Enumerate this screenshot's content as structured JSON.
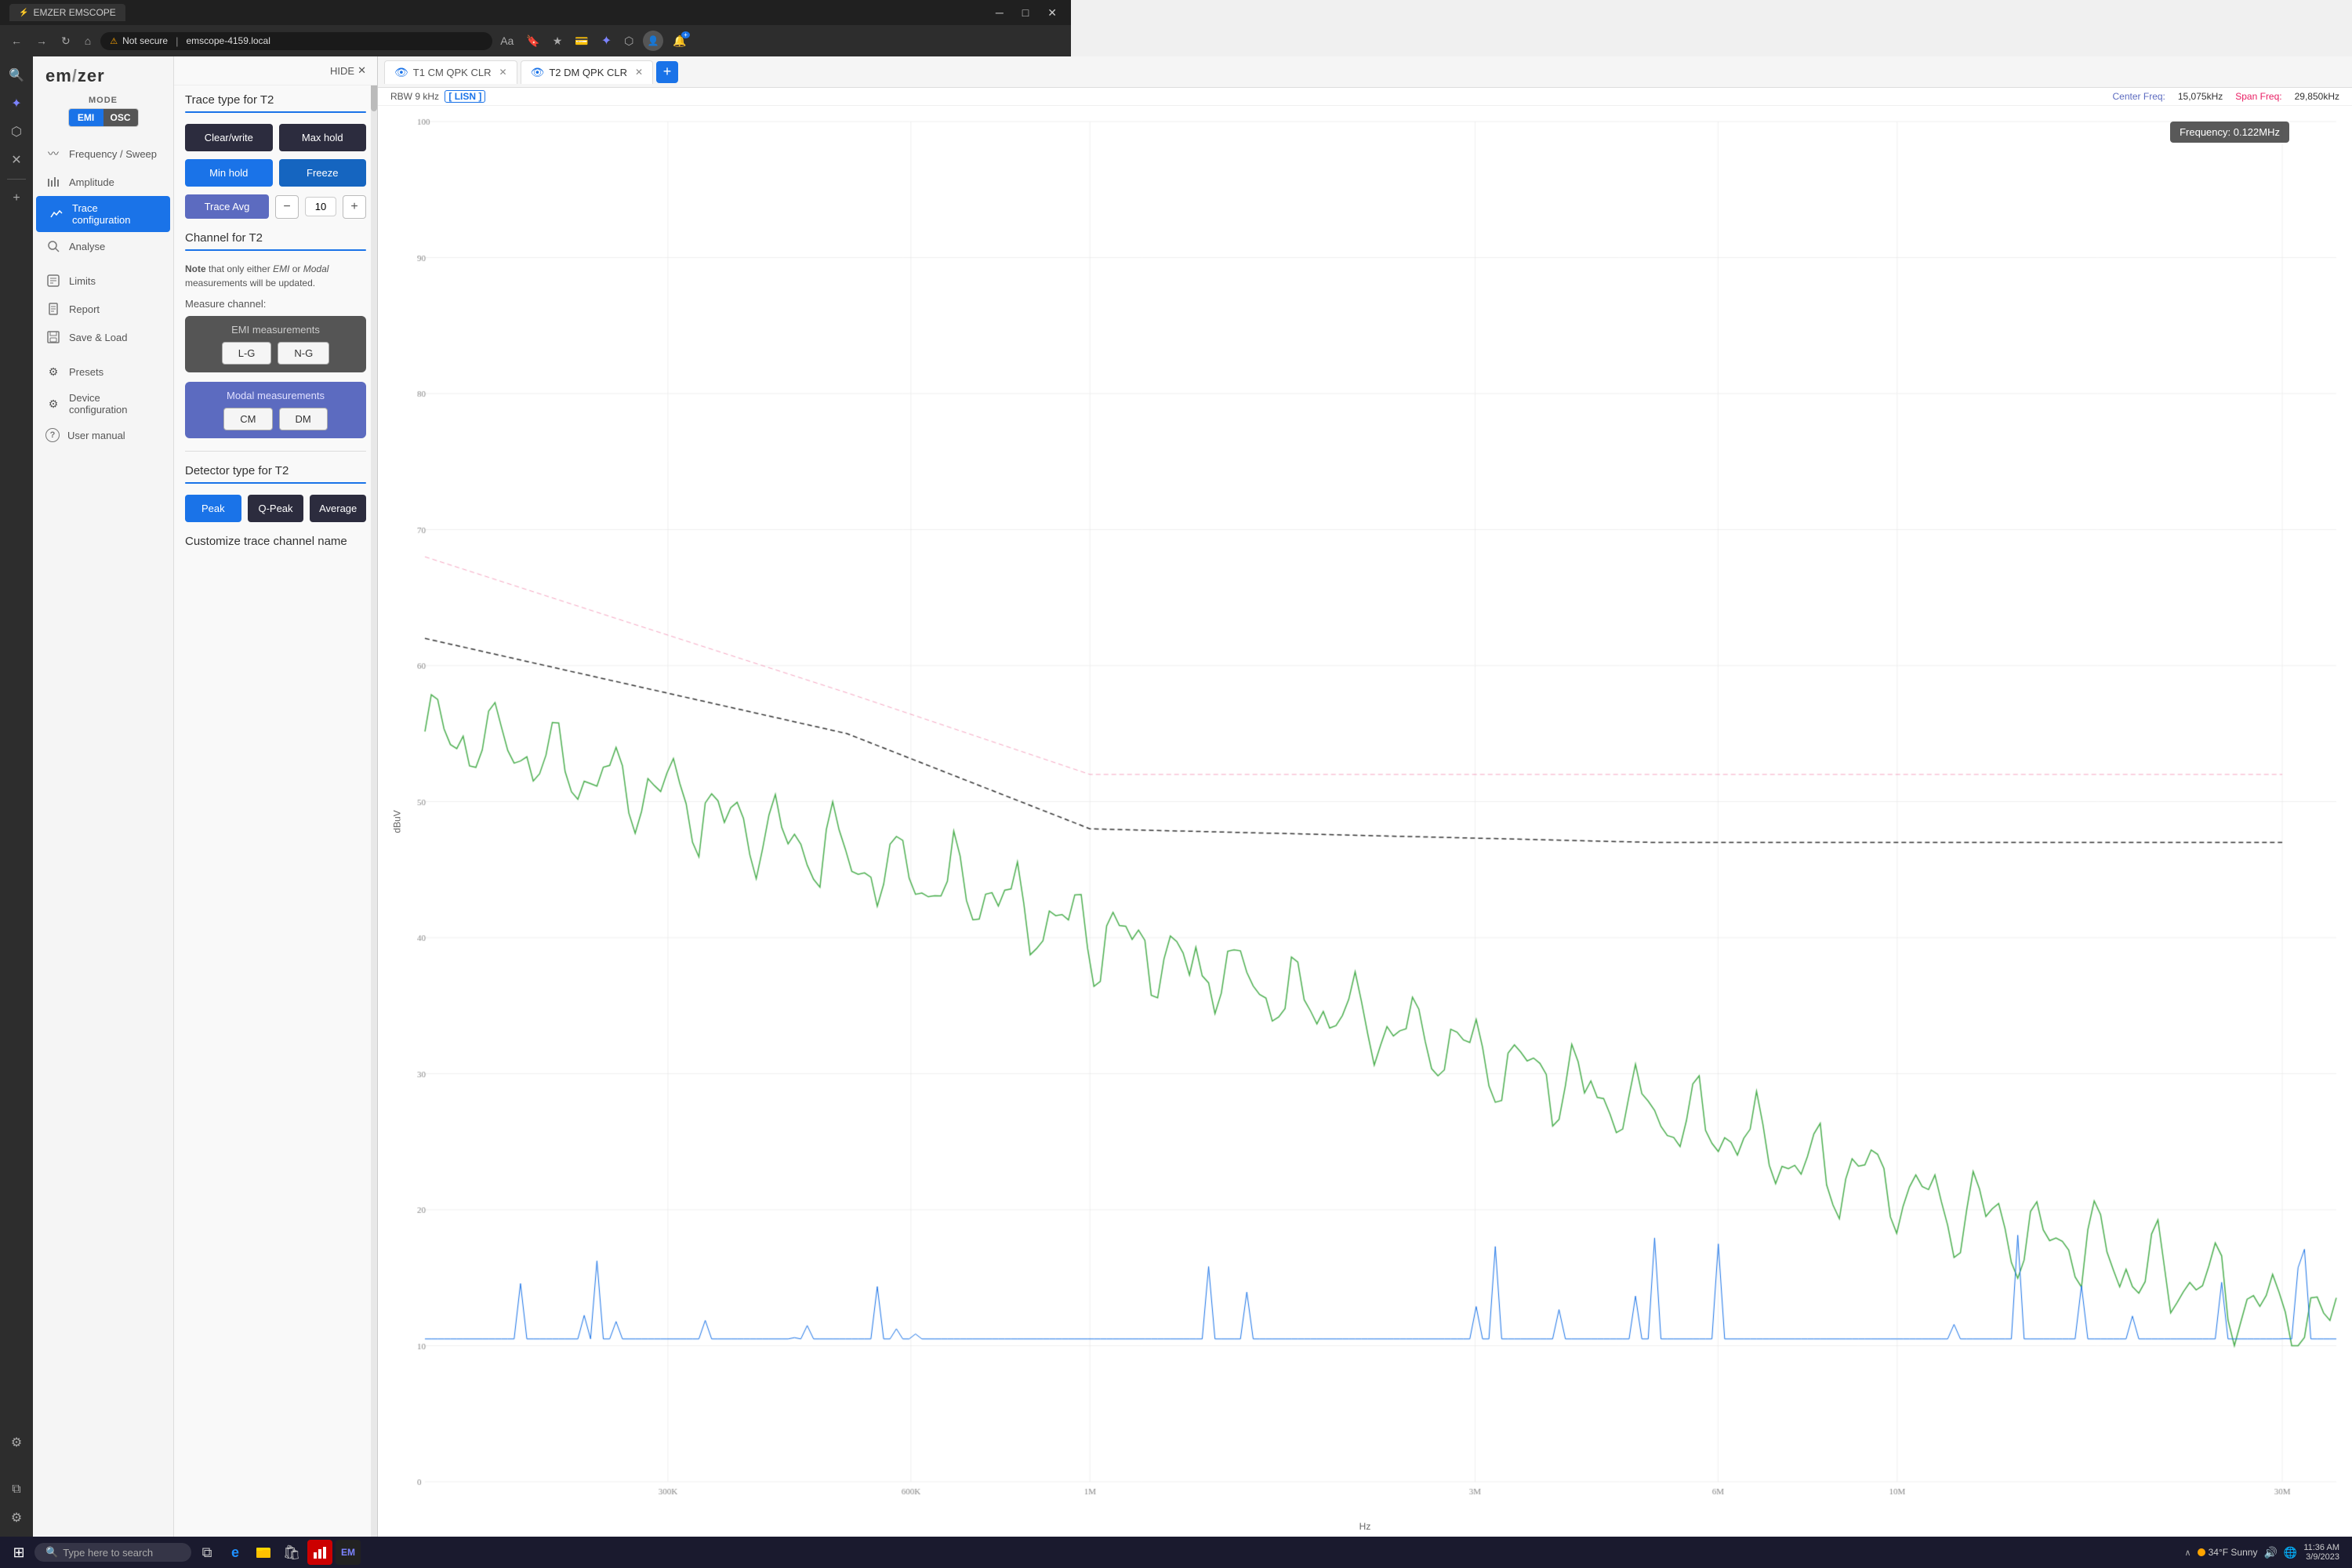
{
  "browser": {
    "title": "EMZER EMSCOPE",
    "tab_title": "EMZER EMSCOPE",
    "tab_icon": "⚡",
    "url": "emscope-4159.local",
    "security": "Not secure",
    "nav_back": "←",
    "nav_forward": "→",
    "nav_refresh": "↻",
    "nav_home": "⌂",
    "win_minimize": "─",
    "win_maximize": "□",
    "win_close": "✕",
    "toolbar_icons": [
      "Aa",
      "🔖",
      "★",
      "💳"
    ]
  },
  "browser_sidebar": {
    "icons": [
      {
        "name": "back-icon",
        "glyph": "←"
      },
      {
        "name": "refresh-icon",
        "glyph": "↻"
      },
      {
        "name": "home-icon",
        "glyph": "⌂"
      },
      {
        "name": "edge-icon",
        "glyph": "e"
      },
      {
        "name": "copilot-icon",
        "glyph": "✦"
      },
      {
        "name": "extensions-icon",
        "glyph": "⬡"
      },
      {
        "name": "x-close-icon",
        "glyph": "✕"
      },
      {
        "name": "search-icon",
        "glyph": "🔍"
      },
      {
        "name": "copilot2-icon",
        "glyph": "✦"
      },
      {
        "name": "settings-browser-icon",
        "glyph": "⚙"
      },
      {
        "name": "add-icon",
        "glyph": "+"
      },
      {
        "name": "browser-sidebar-settings",
        "glyph": "⚙"
      }
    ]
  },
  "app": {
    "logo": "em/zer",
    "mode_label": "MODE",
    "mode_emi": "EMI",
    "mode_osc": "OSC"
  },
  "nav": {
    "items": [
      {
        "id": "frequency",
        "label": "Frequency / Sweep",
        "icon": "〰"
      },
      {
        "id": "amplitude",
        "label": "Amplitude",
        "icon": "📊"
      },
      {
        "id": "trace",
        "label": "Trace configuration",
        "icon": "📈"
      },
      {
        "id": "analyse",
        "label": "Analyse",
        "icon": "🔍"
      },
      {
        "id": "limits",
        "label": "Limits",
        "icon": "📋"
      },
      {
        "id": "report",
        "label": "Report",
        "icon": "📄"
      },
      {
        "id": "save-load",
        "label": "Save & Load",
        "icon": "💾"
      },
      {
        "id": "presets",
        "label": "Presets",
        "icon": "⚙"
      },
      {
        "id": "device-config",
        "label": "Device configuration",
        "icon": "⚙"
      },
      {
        "id": "user-manual",
        "label": "User manual",
        "icon": "?"
      }
    ]
  },
  "panel": {
    "hide_label": "HIDE",
    "trace_type_title": "Trace type for T2",
    "buttons": {
      "clear_write": "Clear/write",
      "max_hold": "Max hold",
      "min_hold": "Min hold",
      "freeze": "Freeze"
    },
    "trace_avg_label": "Trace Avg",
    "trace_avg_value": "10",
    "channel_title": "Channel for T2",
    "note_text": "Note that only either ",
    "note_emi": "EMI",
    "note_or": " or ",
    "note_modal": "Modal",
    "note_rest": " measurements will be updated.",
    "measure_channel_label": "Measure channel:",
    "emi_box": {
      "title": "EMI measurements",
      "btn_lg": "L-G",
      "btn_ng": "N-G"
    },
    "modal_box": {
      "title": "Modal measurements",
      "btn_cm": "CM",
      "btn_dm": "DM"
    },
    "detector_title": "Detector type for T2",
    "detector_buttons": {
      "peak": "Peak",
      "qpeak": "Q-Peak",
      "average": "Average"
    },
    "customize_title": "Customize trace channel name"
  },
  "tabs": [
    {
      "id": "t1",
      "label": "T1 CM QPK CLR",
      "closeable": true
    },
    {
      "id": "t2",
      "label": "T2 DM QPK CLR",
      "closeable": true
    }
  ],
  "chart": {
    "rbw_label": "RBW",
    "rbw_value": "9 kHz",
    "lisn_badge": "[ LISN ]",
    "center_freq_label": "Center Freq:",
    "center_freq_value": "15,075kHz",
    "span_freq_label": "Span Freq:",
    "span_freq_value": "29,850kHz",
    "tooltip": "Frequency: 0.122MHz",
    "y_axis_label": "dBuV",
    "x_axis_label": "Hz",
    "y_max": 100,
    "y_min": 0,
    "y_ticks": [
      0,
      10,
      20,
      30,
      40,
      50,
      60,
      70,
      80,
      90,
      100
    ],
    "x_labels": [
      "300K",
      "600K",
      "1M",
      "3M",
      "6M",
      "10M",
      "30M"
    ]
  },
  "taskbar": {
    "start_icon": "⊞",
    "search_placeholder": "Type here to search",
    "search_icon": "🔍",
    "icons": [
      {
        "name": "task-view-icon",
        "glyph": "⧉"
      },
      {
        "name": "edge-taskbar-icon",
        "glyph": "e"
      },
      {
        "name": "explorer-icon",
        "glyph": "📁"
      },
      {
        "name": "store-icon",
        "glyph": "🛍"
      },
      {
        "name": "chart-app-icon",
        "glyph": "📊"
      }
    ],
    "weather": "34°F Sunny",
    "time": "11:36 AM",
    "date": "3/9/2023"
  }
}
